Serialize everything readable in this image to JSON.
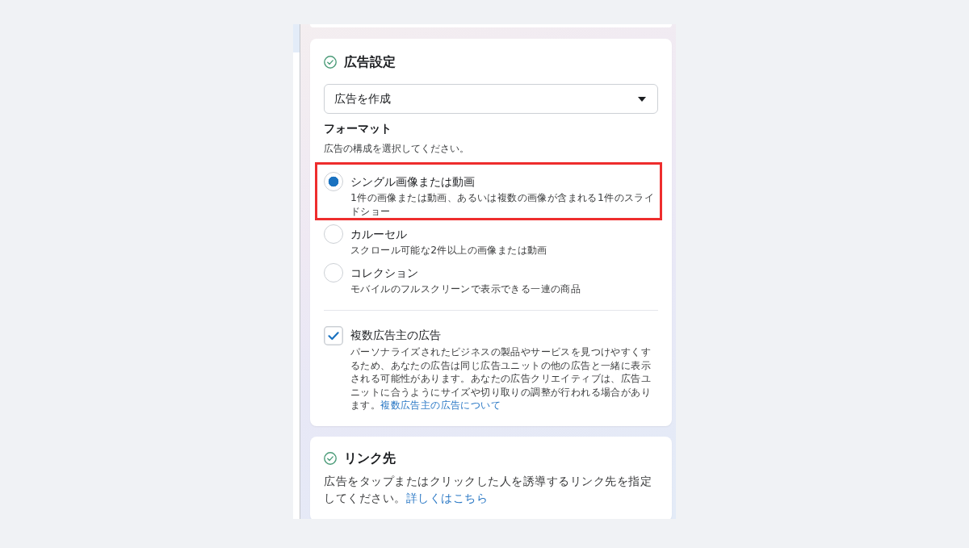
{
  "ad_settings": {
    "title": "広告設定",
    "completed": true,
    "creation_mode": {
      "value": "広告を作成"
    },
    "format": {
      "heading": "フォーマット",
      "hint": "広告の構成を選択してください。",
      "options": [
        {
          "label": "シングル画像または動画",
          "description": "1件の画像または動画、あるいは複数の画像が含まれる1件のスライドショー",
          "selected": true,
          "highlighted": true
        },
        {
          "label": "カルーセル",
          "description": "スクロール可能な2件以上の画像または動画",
          "selected": false,
          "highlighted": false
        },
        {
          "label": "コレクション",
          "description": "モバイルのフルスクリーンで表示できる一連の商品",
          "selected": false,
          "highlighted": false
        }
      ]
    },
    "multi_advertiser_ads": {
      "label": "複数広告主の広告",
      "checked": true,
      "description": "パーソナライズされたビジネスの製品やサービスを見つけやすくするため、あなたの広告は同じ広告ユニットの他の広告と一緒に表示される可能性があります。あなたの広告クリエイティブは、広告ユニットに合うようにサイズや切り取りの調整が行われる場合があります。",
      "link": "複数広告主の広告について"
    }
  },
  "destination": {
    "title": "リンク先",
    "completed": true,
    "description": "広告をタップまたはクリックした人を誘導するリンク先を指定してください。",
    "link": "詳しくはこちら"
  }
}
